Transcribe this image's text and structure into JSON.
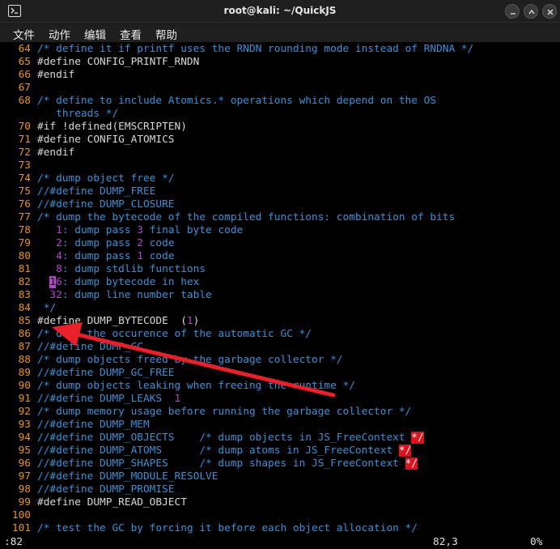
{
  "window": {
    "title": "root@kali: ~/QuickJS",
    "icon": "terminal-icon"
  },
  "menu": [
    {
      "label": "文件"
    },
    {
      "label": "动作"
    },
    {
      "label": "编辑"
    },
    {
      "label": "查看"
    },
    {
      "label": "帮助"
    }
  ],
  "editor": {
    "lines": [
      {
        "n": "64",
        "t": [
          {
            "c": "comment",
            "s": "/* define it if printf uses the RNDN rounding mode instead of RNDNA */"
          }
        ]
      },
      {
        "n": "65",
        "t": [
          {
            "c": "pre",
            "s": "#define CONFIG_PRINTF_RNDN"
          }
        ]
      },
      {
        "n": "66",
        "t": [
          {
            "c": "pre",
            "s": "#endif"
          }
        ]
      },
      {
        "n": "67",
        "t": []
      },
      {
        "n": "68",
        "t": [
          {
            "c": "comment",
            "s": "/* define to include Atomics.* operations which depend on the OS"
          }
        ]
      },
      {
        "n": "",
        "t": [
          {
            "c": "comment",
            "s": "   threads */"
          }
        ]
      },
      {
        "n": "70",
        "t": [
          {
            "c": "pre",
            "s": "#if !defined(EMSCRIPTEN)"
          }
        ]
      },
      {
        "n": "71",
        "t": [
          {
            "c": "pre",
            "s": "#define CONFIG_ATOMICS"
          }
        ]
      },
      {
        "n": "72",
        "t": [
          {
            "c": "pre",
            "s": "#endif"
          }
        ]
      },
      {
        "n": "73",
        "t": []
      },
      {
        "n": "74",
        "t": [
          {
            "c": "comment",
            "s": "/* dump object free */"
          }
        ]
      },
      {
        "n": "75",
        "t": [
          {
            "c": "comment",
            "s": "//#define DUMP_FREE"
          }
        ]
      },
      {
        "n": "76",
        "t": [
          {
            "c": "comment",
            "s": "//#define DUMP_CLOSURE"
          }
        ]
      },
      {
        "n": "77",
        "t": [
          {
            "c": "comment",
            "s": "/* dump the bytecode of the compiled functions: combination of bits"
          }
        ]
      },
      {
        "n": "78",
        "t": [
          {
            "c": "num",
            "s": "   1"
          },
          {
            "c": "comment",
            "s": ": dump pass "
          },
          {
            "c": "num",
            "s": "3"
          },
          {
            "c": "comment",
            "s": " final byte code"
          }
        ]
      },
      {
        "n": "79",
        "t": [
          {
            "c": "num",
            "s": "   2"
          },
          {
            "c": "comment",
            "s": ": dump pass "
          },
          {
            "c": "num",
            "s": "2"
          },
          {
            "c": "comment",
            "s": " code"
          }
        ]
      },
      {
        "n": "80",
        "t": [
          {
            "c": "num",
            "s": "   4"
          },
          {
            "c": "comment",
            "s": ": dump pass "
          },
          {
            "c": "num",
            "s": "1"
          },
          {
            "c": "comment",
            "s": " code"
          }
        ]
      },
      {
        "n": "81",
        "t": [
          {
            "c": "num",
            "s": "   8"
          },
          {
            "c": "comment",
            "s": ": dump stdlib functions"
          }
        ]
      },
      {
        "n": "82",
        "t": [
          {
            "c": "plain",
            "s": "  "
          },
          {
            "c": "cursor",
            "s": "1"
          },
          {
            "c": "num",
            "s": "6"
          },
          {
            "c": "comment",
            "s": ": dump bytecode in hex"
          }
        ]
      },
      {
        "n": "83",
        "t": [
          {
            "c": "num",
            "s": "  32"
          },
          {
            "c": "comment",
            "s": ": dump line number table"
          }
        ]
      },
      {
        "n": "84",
        "t": [
          {
            "c": "comment",
            "s": " */"
          }
        ]
      },
      {
        "n": "85",
        "t": [
          {
            "c": "pre",
            "s": "#define DUMP_BYTECODE  ("
          },
          {
            "c": "num",
            "s": "1"
          },
          {
            "c": "pre",
            "s": ")"
          }
        ]
      },
      {
        "n": "86",
        "t": [
          {
            "c": "comment",
            "s": "/* dump the occurence of the automatic GC */"
          }
        ]
      },
      {
        "n": "87",
        "t": [
          {
            "c": "comment",
            "s": "//#define DUMP_GC"
          }
        ]
      },
      {
        "n": "88",
        "t": [
          {
            "c": "comment",
            "s": "/* dump objects freed by the garbage collector */"
          }
        ]
      },
      {
        "n": "89",
        "t": [
          {
            "c": "comment",
            "s": "//#define DUMP_GC_FREE"
          }
        ]
      },
      {
        "n": "90",
        "t": [
          {
            "c": "comment",
            "s": "/* dump objects leaking when freeing the runtime */"
          }
        ]
      },
      {
        "n": "91",
        "t": [
          {
            "c": "comment",
            "s": "//#define DUMP_LEAKS  "
          },
          {
            "c": "num",
            "s": "1"
          }
        ]
      },
      {
        "n": "92",
        "t": [
          {
            "c": "comment",
            "s": "/* dump memory usage before running the garbage collector */"
          }
        ]
      },
      {
        "n": "93",
        "t": [
          {
            "c": "comment",
            "s": "//#define DUMP_MEM"
          }
        ]
      },
      {
        "n": "94",
        "t": [
          {
            "c": "comment",
            "s": "//#define DUMP_OBJECTS    /* dump objects in JS_FreeContext "
          },
          {
            "c": "err",
            "s": "*/"
          }
        ]
      },
      {
        "n": "95",
        "t": [
          {
            "c": "comment",
            "s": "//#define DUMP_ATOMS      /* dump atoms in JS_FreeContext "
          },
          {
            "c": "err",
            "s": "*/"
          }
        ]
      },
      {
        "n": "96",
        "t": [
          {
            "c": "comment",
            "s": "//#define DUMP_SHAPES     /* dump shapes in JS_FreeContext "
          },
          {
            "c": "err",
            "s": "*/"
          }
        ]
      },
      {
        "n": "97",
        "t": [
          {
            "c": "comment",
            "s": "//#define DUMP_MODULE_RESOLVE"
          }
        ]
      },
      {
        "n": "98",
        "t": [
          {
            "c": "comment",
            "s": "//#define DUMP_PROMISE"
          }
        ]
      },
      {
        "n": "99",
        "t": [
          {
            "c": "pre",
            "s": "#define DUMP_READ_OBJECT"
          }
        ]
      },
      {
        "n": "100",
        "t": []
      },
      {
        "n": "101",
        "t": [
          {
            "c": "comment",
            "s": "/* test the GC by forcing it before each object allocation */"
          }
        ]
      }
    ]
  },
  "status": {
    "command": ":82",
    "position": "82,3",
    "percent": "0%"
  },
  "colors": {
    "arrow": "#e8202a",
    "line_number": "#e8941e",
    "comment": "#3f8fd4",
    "number": "#b147c8"
  }
}
